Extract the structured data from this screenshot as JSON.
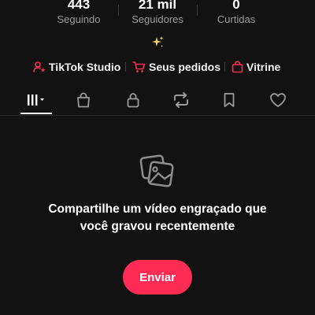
{
  "stats": [
    {
      "value": "443",
      "label": "Seguindo"
    },
    {
      "value": "21 mil",
      "label": "Seguidores"
    },
    {
      "value": "0",
      "label": "Curtidas"
    }
  ],
  "quick_links": [
    {
      "label": "TikTok Studio",
      "icon": "person-star-icon"
    },
    {
      "label": "Seus pedidos",
      "icon": "cart-icon"
    },
    {
      "label": "Vitrine",
      "icon": "shopping-bag-icon"
    }
  ],
  "tabs": [
    {
      "icon": "videos-grid-icon",
      "selected": true
    },
    {
      "icon": "shop-bag-icon",
      "selected": false
    },
    {
      "icon": "lock-icon",
      "selected": false
    },
    {
      "icon": "repost-icon",
      "selected": false
    },
    {
      "icon": "bookmark-icon",
      "selected": false
    },
    {
      "icon": "heart-icon",
      "selected": false
    }
  ],
  "empty_state": {
    "icon": "photo-stack-icon",
    "message": "Compartilhe um vídeo engraçado que você gravou recentemente",
    "button_label": "Enviar"
  },
  "colors": {
    "background": "#121212",
    "accent": "#fe2c55",
    "sparkle": "#f5d36b",
    "muted_text": "#9a9a9a"
  }
}
